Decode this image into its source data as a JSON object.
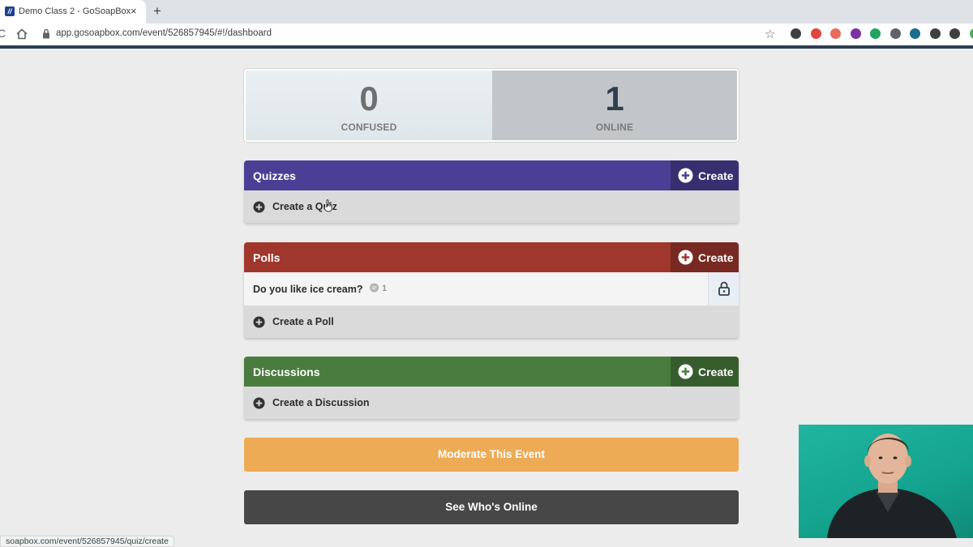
{
  "browser": {
    "tab_title": "Demo Class 2 - GoSoapBox",
    "favicon_letter": "//",
    "tab_close": "×",
    "new_tab": "+",
    "reload": "C",
    "url": "app.gosoapbox.com/event/526857945/#!/dashboard",
    "bookmark_star": "☆",
    "extensions": [
      {
        "name": "extension-icon-1",
        "color": "#3c4043"
      },
      {
        "name": "extension-icon-2",
        "color": "#e0463c"
      },
      {
        "name": "extension-icon-3",
        "color": "#e76a5c"
      },
      {
        "name": "onenote-icon",
        "color": "#7b2fa6"
      },
      {
        "name": "google-drive-icon",
        "color": "#1fa463"
      },
      {
        "name": "extension-icon-6",
        "color": "#5f6368"
      },
      {
        "name": "extension-icon-7",
        "color": "#1c6c8c"
      },
      {
        "name": "extension-icon-8",
        "color": "#3c4043"
      },
      {
        "name": "rocket-icon",
        "color": "#3c4043"
      },
      {
        "name": "extension-icon-10",
        "color": "#4caf50"
      }
    ]
  },
  "stats": {
    "confused": {
      "value": "0",
      "label": "CONFUSED"
    },
    "online": {
      "value": "1",
      "label": "ONLINE"
    }
  },
  "sections": {
    "quizzes": {
      "title": "Quizzes",
      "create_label": "Create",
      "add_label": "Create a Quiz",
      "color": "#4a3f95"
    },
    "polls": {
      "title": "Polls",
      "create_label": "Create",
      "items": [
        {
          "question": "Do you like ice cream?",
          "responses": "1"
        }
      ],
      "add_label": "Create a Poll",
      "color": "#a0372c"
    },
    "discussions": {
      "title": "Discussions",
      "create_label": "Create",
      "add_label": "Create a Discussion",
      "color": "#4a7c3f"
    }
  },
  "actions": {
    "moderate": "Moderate This Event",
    "see_online": "See Who's Online"
  },
  "status_url": "soapbox.com/event/526857945/quiz/create"
}
